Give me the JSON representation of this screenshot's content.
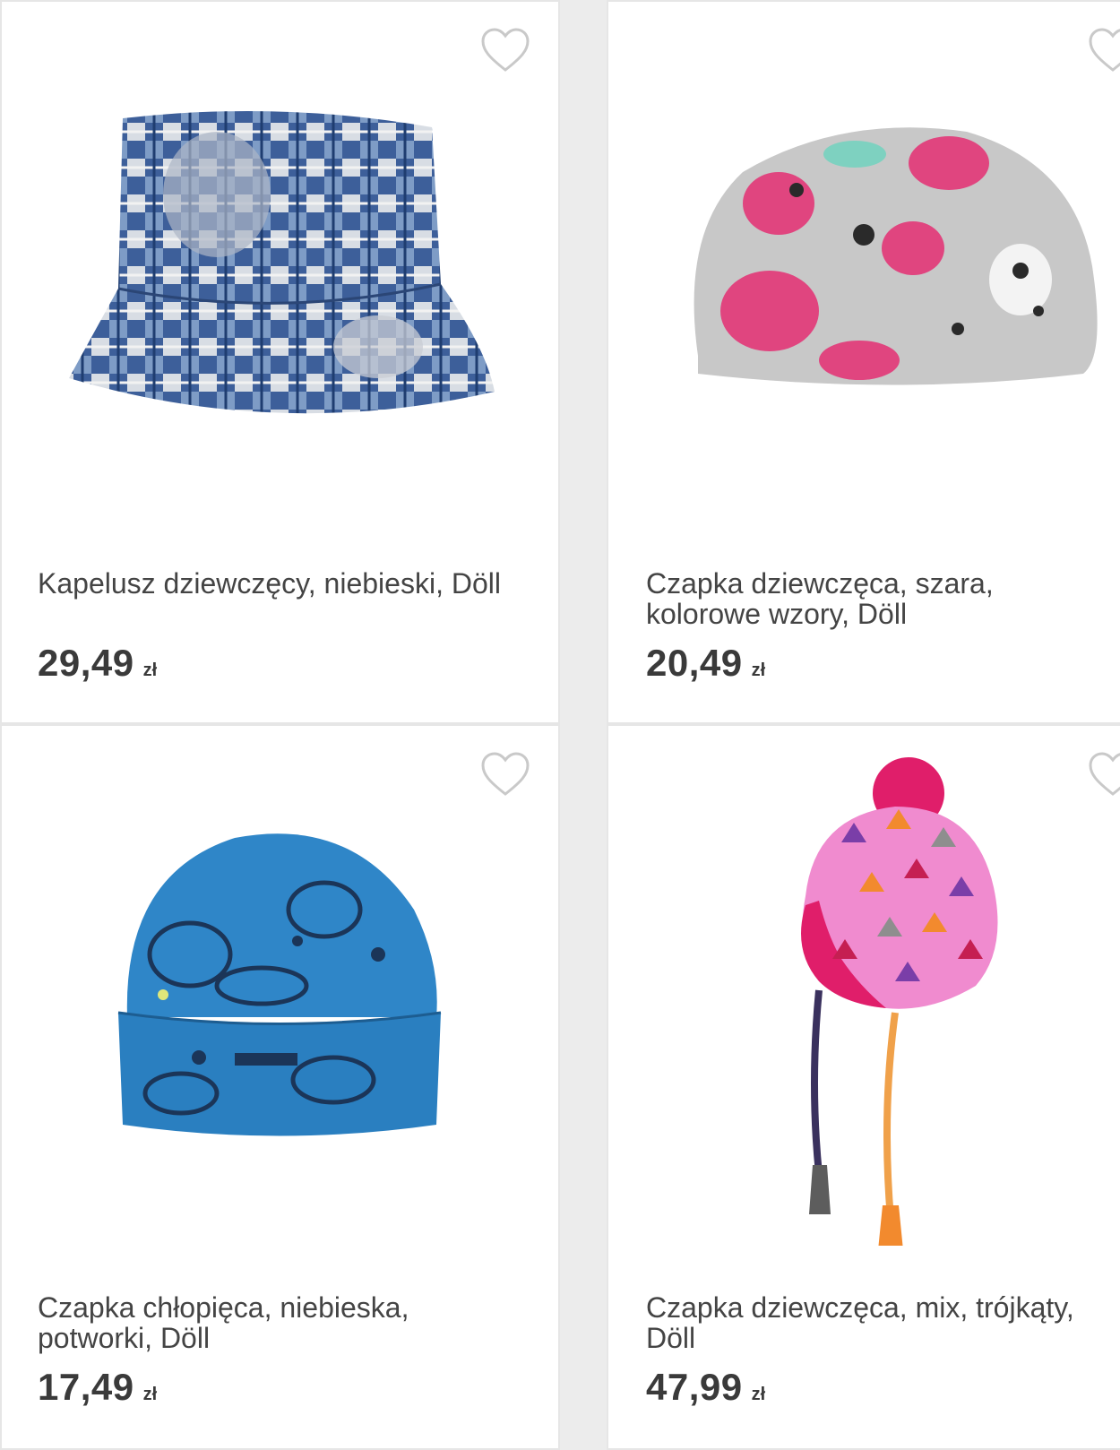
{
  "colors": {
    "heart_outline": "#c9c9c9",
    "text": "#444444",
    "price": "#3a3a3a"
  },
  "products": [
    {
      "name": "Kapelusz dziewczęcy, niebieski, Döll",
      "price": "29,49",
      "currency": "zł",
      "image_icon": "bucket-hat-image",
      "favorite_icon": "heart-outline-icon"
    },
    {
      "name": "Czapka dziewczęca, szara, kolorowe wzory, Döll",
      "price": "20,49",
      "currency": "zł",
      "image_icon": "slouchy-beanie-image",
      "favorite_icon": "heart-outline-icon"
    },
    {
      "name": "Czapka chłopięca, niebieska, potworki, Döll",
      "price": "17,49",
      "currency": "zł",
      "image_icon": "blue-beanie-image",
      "favorite_icon": "heart-outline-icon"
    },
    {
      "name": "Czapka dziewczęca, mix, trójkąty, Döll",
      "price": "47,99",
      "currency": "zł",
      "image_icon": "pompom-hat-image",
      "favorite_icon": "heart-outline-icon"
    }
  ]
}
